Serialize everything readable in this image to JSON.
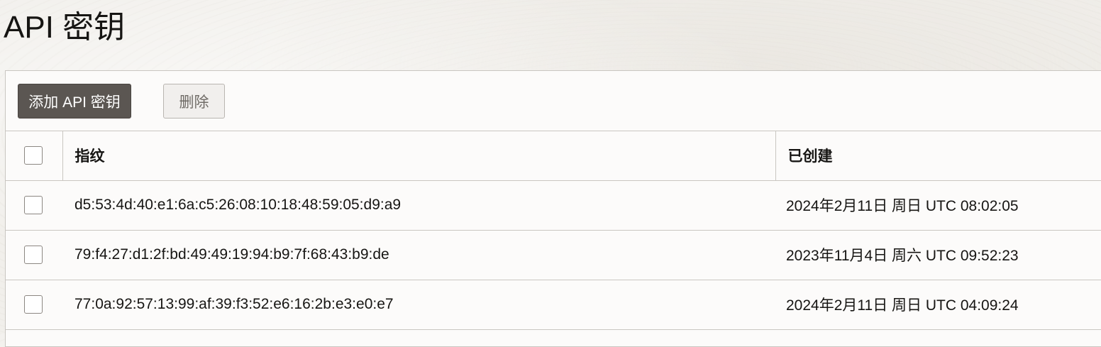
{
  "page": {
    "title": "API 密钥"
  },
  "toolbar": {
    "add_label": "添加 API 密钥",
    "delete_label": "删除"
  },
  "table": {
    "columns": {
      "fingerprint": "指纹",
      "created": "已创建"
    },
    "rows": [
      {
        "fingerprint": "d5:53:4d:40:e1:6a:c5:26:08:10:18:48:59:05:d9:a9",
        "created": "2024年2月11日 周日 UTC 08:02:05"
      },
      {
        "fingerprint": "79:f4:27:d1:2f:bd:49:49:19:94:b9:7f:68:43:b9:de",
        "created": "2023年11月4日 周六 UTC 09:52:23"
      },
      {
        "fingerprint": "77:0a:92:57:13:99:af:39:f3:52:e6:16:2b:e3:e0:e7",
        "created": "2024年2月11日 周日 UTC 04:09:24"
      }
    ]
  },
  "colors": {
    "primary_button": "#5b5652",
    "border": "#c9c6c1",
    "panel_background": "#fcfbfa",
    "text": "#161513"
  }
}
